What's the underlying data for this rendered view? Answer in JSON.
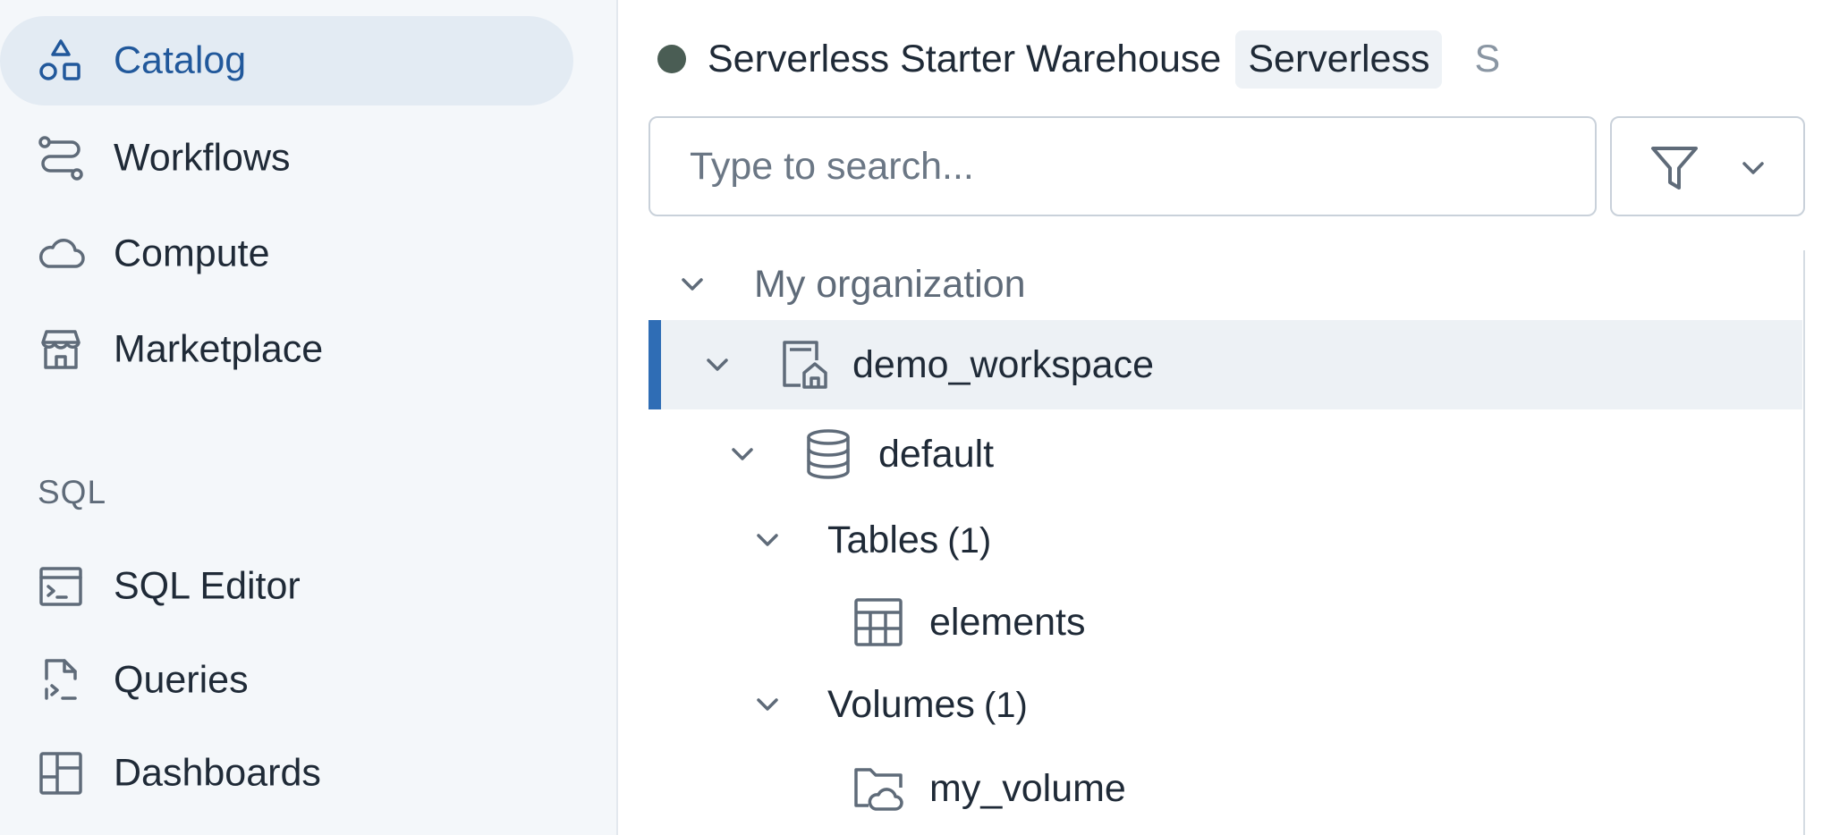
{
  "sidebar": {
    "items": [
      {
        "label": "Catalog",
        "icon": "catalog-icon",
        "active": true
      },
      {
        "label": "Workflows",
        "icon": "workflows-icon"
      },
      {
        "label": "Compute",
        "icon": "cloud-icon"
      },
      {
        "label": "Marketplace",
        "icon": "storefront-icon"
      }
    ],
    "sql_section_label": "SQL",
    "sql_items": [
      {
        "label": "SQL Editor",
        "icon": "sql-editor-icon"
      },
      {
        "label": "Queries",
        "icon": "query-file-icon"
      },
      {
        "label": "Dashboards",
        "icon": "dashboard-icon"
      }
    ]
  },
  "warehouse": {
    "name": "Serverless Starter Warehouse",
    "badge": "Serverless",
    "extra": "S",
    "status_color": "#4a5d54"
  },
  "search": {
    "placeholder": "Type to search..."
  },
  "tree": {
    "organization": "My organization",
    "workspace": "demo_workspace",
    "schema": "default",
    "tables_label": "Tables",
    "tables_count": "(1)",
    "table_item": "elements",
    "volumes_label": "Volumes",
    "volumes_count": "(1)",
    "volume_item": "my_volume"
  },
  "colors": {
    "accent": "#2f6db5",
    "active_nav_bg": "#e3ebf3",
    "active_nav_text": "#21589b"
  }
}
